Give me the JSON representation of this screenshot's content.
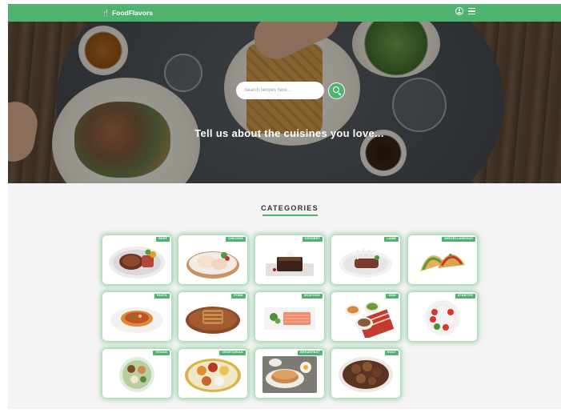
{
  "header": {
    "brand": "FoodFlavors",
    "brand_icon": "utensils-icon",
    "icons": [
      "user-circle-icon",
      "hamburger-menu-icon"
    ]
  },
  "hero": {
    "search_placeholder": "Search recipes here...",
    "search_icon": "search-icon",
    "tagline": "Tell us about the cuisines you love..."
  },
  "categories": {
    "title": "CATEGORIES",
    "items": [
      {
        "label": "BEEF"
      },
      {
        "label": "CHICKEN"
      },
      {
        "label": "DESSERT"
      },
      {
        "label": "LAMB"
      },
      {
        "label": "MISCELLANEOUS"
      },
      {
        "label": "PASTA"
      },
      {
        "label": "PORK"
      },
      {
        "label": "SEAFOOD"
      },
      {
        "label": "SIDE"
      },
      {
        "label": "STARTER"
      },
      {
        "label": "VEGAN"
      },
      {
        "label": "VEGETARIAN"
      },
      {
        "label": "BREAKFAST"
      },
      {
        "label": "GOAT"
      }
    ]
  },
  "colors": {
    "brand_green": "#4fb370",
    "page_background": "#f3f3f3"
  }
}
